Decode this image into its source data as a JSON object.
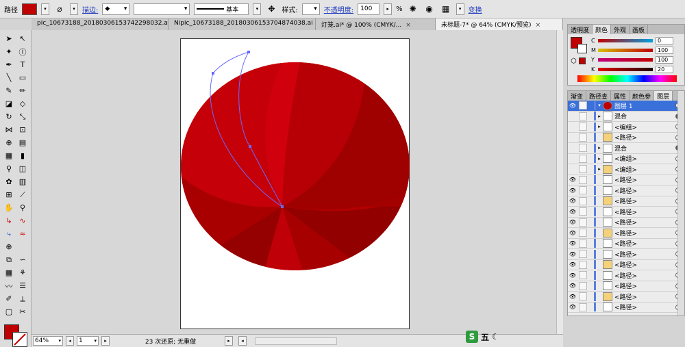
{
  "control_bar": {
    "object_type": "路径",
    "fill_color": "#c00000",
    "stroke_label": "描边:",
    "stroke_profile": "基本",
    "style_label": "样式:",
    "opacity_label": "不透明度:",
    "opacity_value": "100",
    "opacity_unit": "%",
    "transform_label": "变换"
  },
  "doc_tabs": [
    {
      "label": "pic_10673188_20180306153742298032.ai*",
      "active": false
    },
    {
      "label": "Nipic_10673188_20180306153704874038.ai",
      "active": false
    },
    {
      "label": "灯笼.ai* @ 100% (CMYK/...",
      "active": false
    },
    {
      "label": "未标题-7* @ 64% (CMYK/预览)",
      "active": true
    }
  ],
  "status_bar": {
    "zoom": "64%",
    "artboard_number": "1",
    "status_text": "23 次还原; 无重做"
  },
  "color_panel": {
    "tabs": [
      "透明度",
      "颜色",
      "外观",
      "画板"
    ],
    "active_tab": "颜色",
    "channels": [
      {
        "name": "C",
        "value": "0",
        "color": "#00a0e0"
      },
      {
        "name": "M",
        "value": "100",
        "color": "#e0007a"
      },
      {
        "name": "Y",
        "value": "100",
        "color": "#f0e000"
      },
      {
        "name": "K",
        "value": "20",
        "color": "#444444"
      }
    ],
    "current_color": "#c00000"
  },
  "layers_panel": {
    "tabs": [
      "渐变",
      "路径查",
      "属性",
      "颜色参",
      "图层"
    ],
    "active_tab": "图层",
    "rows": [
      {
        "name": "图层 1",
        "level": 0,
        "selected": true,
        "eye": true,
        "arrow": "▾",
        "target": "ring"
      },
      {
        "name": "混合",
        "level": 1,
        "selected": false,
        "eye": false,
        "arrow": "▸",
        "target": "filled"
      },
      {
        "name": "<编组>",
        "level": 1,
        "selected": false,
        "eye": false,
        "arrow": "▸",
        "target": "ring"
      },
      {
        "name": "<路径>",
        "level": 1,
        "selected": false,
        "eye": false,
        "arrow": "",
        "target": "ring"
      },
      {
        "name": "混合",
        "level": 1,
        "selected": false,
        "eye": false,
        "arrow": "▸",
        "target": "filled"
      },
      {
        "name": "<编组>",
        "level": 1,
        "selected": false,
        "eye": false,
        "arrow": "▸",
        "target": "ring"
      },
      {
        "name": "<编组>",
        "level": 1,
        "selected": false,
        "eye": false,
        "arrow": "▸",
        "target": "ring"
      },
      {
        "name": "<路径>",
        "level": 1,
        "selected": false,
        "eye": true,
        "arrow": "",
        "target": "ring"
      },
      {
        "name": "<路径>",
        "level": 1,
        "selected": false,
        "eye": true,
        "arrow": "",
        "target": "ring"
      },
      {
        "name": "<路径>",
        "level": 1,
        "selected": false,
        "eye": true,
        "arrow": "",
        "target": "ring"
      },
      {
        "name": "<路径>",
        "level": 1,
        "selected": false,
        "eye": true,
        "arrow": "",
        "target": "ring"
      },
      {
        "name": "<路径>",
        "level": 1,
        "selected": false,
        "eye": true,
        "arrow": "",
        "target": "ring"
      },
      {
        "name": "<路径>",
        "level": 1,
        "selected": false,
        "eye": true,
        "arrow": "",
        "target": "ring"
      },
      {
        "name": "<路径>",
        "level": 1,
        "selected": false,
        "eye": true,
        "arrow": "",
        "target": "ring"
      },
      {
        "name": "<路径>",
        "level": 1,
        "selected": false,
        "eye": true,
        "arrow": "",
        "target": "ring"
      },
      {
        "name": "<路径>",
        "level": 1,
        "selected": false,
        "eye": true,
        "arrow": "",
        "target": "ring"
      },
      {
        "name": "<路径>",
        "level": 1,
        "selected": false,
        "eye": true,
        "arrow": "",
        "target": "ring"
      },
      {
        "name": "<路径>",
        "level": 1,
        "selected": false,
        "eye": true,
        "arrow": "",
        "target": "ring"
      },
      {
        "name": "<路径>",
        "level": 1,
        "selected": false,
        "eye": true,
        "arrow": "",
        "target": "ring"
      },
      {
        "name": "<路径>",
        "level": 1,
        "selected": false,
        "eye": true,
        "arrow": "",
        "target": "ring"
      }
    ]
  },
  "watermark": "五"
}
